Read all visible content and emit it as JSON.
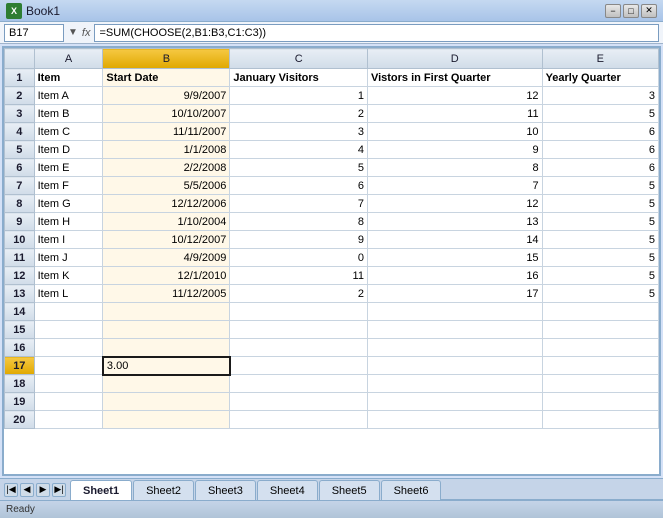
{
  "titleBar": {
    "title": "Book1",
    "minimizeLabel": "−",
    "maximizeLabel": "□",
    "closeLabel": "✕"
  },
  "formulaBar": {
    "nameBox": "B17",
    "fxLabel": "fx",
    "formula": "=SUM(CHOOSE(2,B1:B3,C1:C3))"
  },
  "columns": {
    "rowNum": "#",
    "a": "A",
    "b": "B",
    "c": "C",
    "d": "D",
    "e": "E"
  },
  "headers": {
    "item": "Item",
    "startDate": "Start Date",
    "janVisitors": "January Visitors",
    "firstQuarter": "Vistors in First Quarter",
    "yearlyQuarter": "Yearly Quarter"
  },
  "rows": [
    {
      "rowNum": "1",
      "a": "Item",
      "b": "Start Date",
      "c": "January Visitors",
      "d": "Vistors in First Quarter",
      "e": "Yearly Quarter"
    },
    {
      "rowNum": "2",
      "a": "Item A",
      "b": "9/9/2007",
      "c": "1",
      "d": "12",
      "e": "3"
    },
    {
      "rowNum": "3",
      "a": "Item B",
      "b": "10/10/2007",
      "c": "2",
      "d": "11",
      "e": "5"
    },
    {
      "rowNum": "4",
      "a": "Item C",
      "b": "11/11/2007",
      "c": "3",
      "d": "10",
      "e": "6"
    },
    {
      "rowNum": "5",
      "a": "Item D",
      "b": "1/1/2008",
      "c": "4",
      "d": "9",
      "e": "6"
    },
    {
      "rowNum": "6",
      "a": "Item E",
      "b": "2/2/2008",
      "c": "5",
      "d": "8",
      "e": "6"
    },
    {
      "rowNum": "7",
      "a": "Item F",
      "b": "5/5/2006",
      "c": "6",
      "d": "7",
      "e": "5"
    },
    {
      "rowNum": "8",
      "a": "Item G",
      "b": "12/12/2006",
      "c": "7",
      "d": "12",
      "e": "5"
    },
    {
      "rowNum": "9",
      "a": "Item H",
      "b": "1/10/2004",
      "c": "8",
      "d": "13",
      "e": "5"
    },
    {
      "rowNum": "10",
      "a": "Item I",
      "b": "10/12/2007",
      "c": "9",
      "d": "14",
      "e": "5"
    },
    {
      "rowNum": "11",
      "a": "Item J",
      "b": "4/9/2009",
      "c": "0",
      "d": "15",
      "e": "5"
    },
    {
      "rowNum": "12",
      "a": "Item K",
      "b": "12/1/2010",
      "c": "11",
      "d": "16",
      "e": "5"
    },
    {
      "rowNum": "13",
      "a": "Item L",
      "b": "11/12/2005",
      "c": "2",
      "d": "17",
      "e": "5"
    },
    {
      "rowNum": "14",
      "a": "",
      "b": "",
      "c": "",
      "d": "",
      "e": ""
    },
    {
      "rowNum": "15",
      "a": "",
      "b": "",
      "c": "",
      "d": "",
      "e": ""
    },
    {
      "rowNum": "16",
      "a": "",
      "b": "",
      "c": "",
      "d": "",
      "e": ""
    },
    {
      "rowNum": "17",
      "a": "",
      "b": "3.00",
      "c": "",
      "d": "",
      "e": ""
    },
    {
      "rowNum": "18",
      "a": "",
      "b": "",
      "c": "",
      "d": "",
      "e": ""
    },
    {
      "rowNum": "19",
      "a": "",
      "b": "",
      "c": "",
      "d": "",
      "e": ""
    },
    {
      "rowNum": "20",
      "a": "",
      "b": "",
      "c": "",
      "d": "",
      "e": ""
    }
  ],
  "sheets": [
    "Sheet1",
    "Sheet2",
    "Sheet3",
    "Sheet4",
    "Sheet5",
    "Sheet6"
  ],
  "activeSheet": "Sheet1"
}
